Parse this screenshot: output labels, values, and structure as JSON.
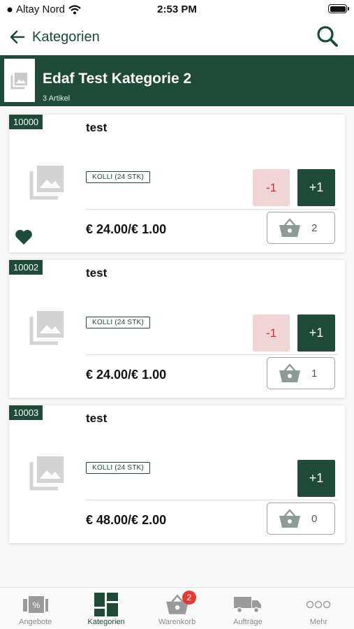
{
  "status_bar": {
    "carrier": "Altay Nord",
    "time": "2:53 PM"
  },
  "nav": {
    "back_label": "Kategorien",
    "back_icon": "arrow-left-icon",
    "search_icon": "search-icon"
  },
  "category": {
    "title": "Edaf Test Kategorie 2",
    "count": "3 Artikel"
  },
  "products": [
    {
      "sku": "10000",
      "name": "test",
      "unit": "KOLLI (24 STK)",
      "price": "€ 24.00/€ 1.00",
      "cart_qty": "2",
      "minus_label": "-1",
      "plus_label": "+1",
      "favorite": true
    },
    {
      "sku": "10002",
      "name": "test",
      "unit": "KOLLI (24 STK)",
      "price": "€ 24.00/€ 1.00",
      "cart_qty": "1",
      "minus_label": "-1",
      "plus_label": "+1",
      "favorite": false
    },
    {
      "sku": "10003",
      "name": "test",
      "unit": "KOLLI (24 STK)",
      "price": "€ 48.00/€ 2.00",
      "cart_qty": "0",
      "plus_label": "+1",
      "favorite": false
    }
  ],
  "tabs": [
    {
      "label": "Angebote",
      "icon": "offers-icon",
      "active": false
    },
    {
      "label": "Kategorien",
      "icon": "categories-grid-icon",
      "active": true
    },
    {
      "label": "Warenkorb",
      "icon": "basket-icon",
      "active": false,
      "badge": "2"
    },
    {
      "label": "Aufträge",
      "icon": "truck-icon",
      "active": false
    },
    {
      "label": "Mehr",
      "icon": "more-dots-icon",
      "active": false
    }
  ],
  "colors": {
    "primary": "#1e4a37",
    "minus_bg": "#f1d5d6",
    "minus_text": "#c4312f",
    "badge": "#e53935"
  }
}
